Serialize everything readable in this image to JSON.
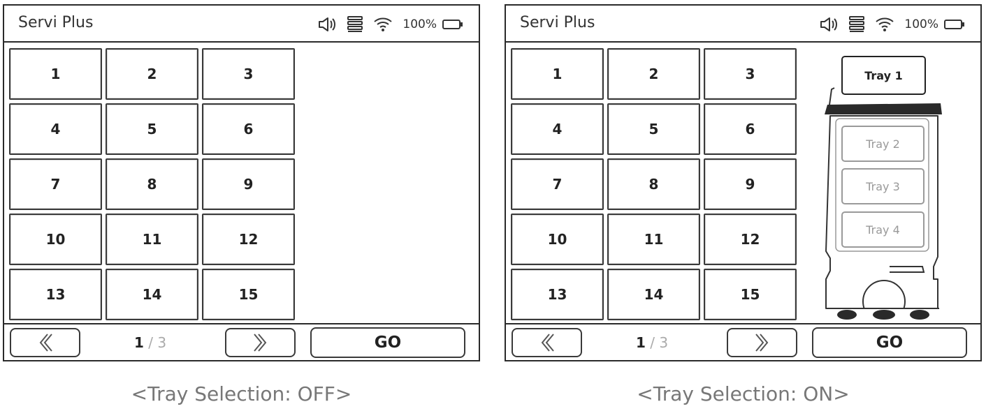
{
  "app_title": "Servi Plus",
  "status": {
    "battery_text": "100%"
  },
  "table_buttons": [
    "1",
    "2",
    "3",
    "4",
    "5",
    "6",
    "7",
    "8",
    "9",
    "10",
    "11",
    "12",
    "13",
    "14",
    "15"
  ],
  "pager": {
    "current": "1",
    "separator": "/",
    "total": "3"
  },
  "go_label": "GO",
  "trays": [
    "Tray 1",
    "Tray 2",
    "Tray 3",
    "Tray 4"
  ],
  "selected_tray": "Tray 1",
  "captions": {
    "off": "<Tray Selection: OFF>",
    "on": "<Tray Selection: ON>"
  },
  "icons": {
    "volume": "speaker-volume-icon",
    "layers": "stacked-lines-icon",
    "wifi": "wifi-icon",
    "battery": "battery-icon",
    "prev": "chevron-left-icon",
    "next": "chevron-right-icon"
  }
}
